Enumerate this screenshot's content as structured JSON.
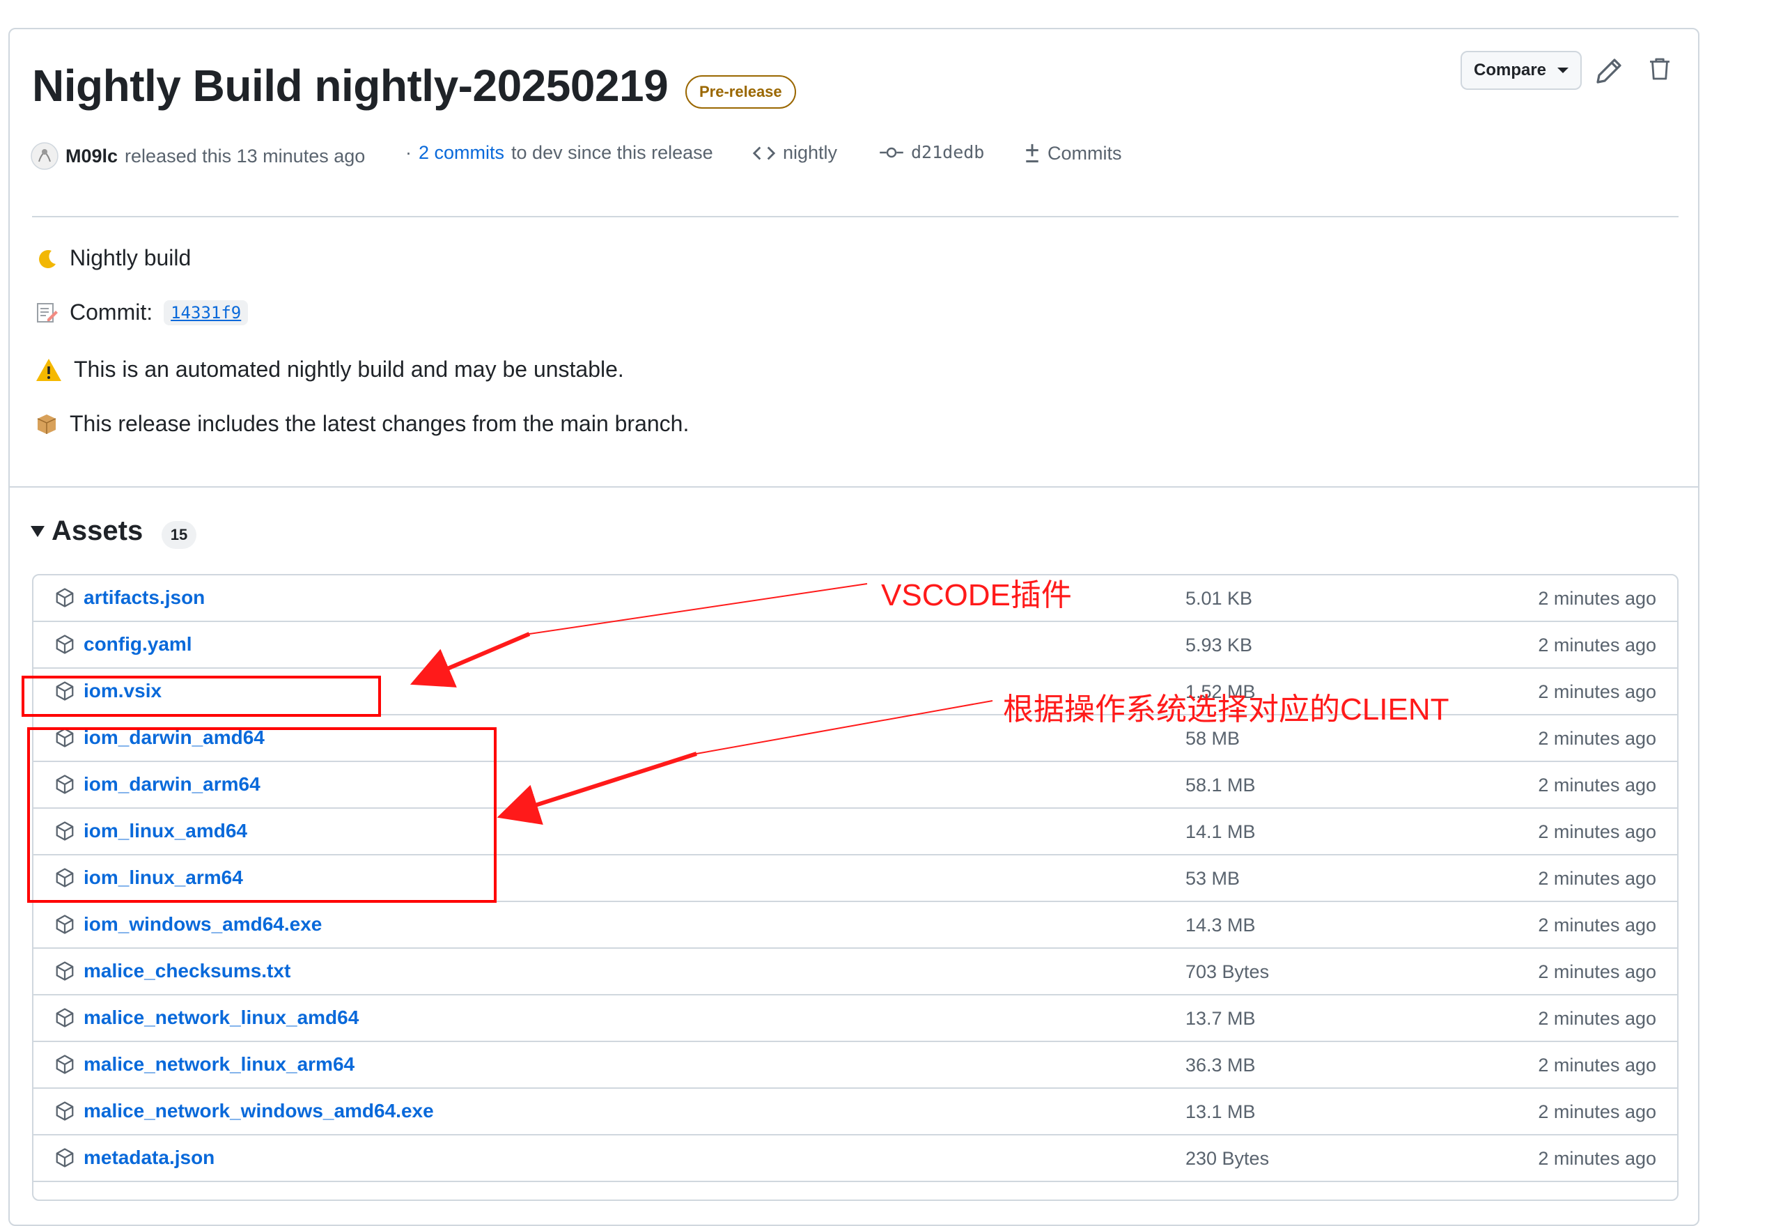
{
  "release": {
    "title": "Nightly Build nightly-20250219",
    "badge": "Pre-release",
    "compare_label": "Compare",
    "author": "M09lc",
    "released_text": "released this 13 minutes ago",
    "commits_link": "2 commits",
    "commits_suffix": "to dev since this release",
    "tag": "nightly",
    "commit_sha": "d21dedb",
    "commits_label": "Commits",
    "icons": [
      "edit-icon",
      "trash-icon",
      "code-icon",
      "commit-icon",
      "compare-icon"
    ]
  },
  "notes": {
    "line1": "Nightly build",
    "line2_prefix": "Commit:",
    "line2_code": "14331f9",
    "line3": "This is an automated nightly build and may be unstable.",
    "line4": "This release includes the latest changes from the main branch."
  },
  "assets": {
    "heading": "Assets",
    "count": "15",
    "rows": [
      {
        "name": "artifacts.json",
        "size": "5.01 KB",
        "time": "2 minutes ago"
      },
      {
        "name": "config.yaml",
        "size": "5.93 KB",
        "time": "2 minutes ago"
      },
      {
        "name": "iom.vsix",
        "size": "1.52 MB",
        "time": "2 minutes ago"
      },
      {
        "name": "iom_darwin_amd64",
        "size": "58 MB",
        "time": "2 minutes ago"
      },
      {
        "name": "iom_darwin_arm64",
        "size": "58.1 MB",
        "time": "2 minutes ago"
      },
      {
        "name": "iom_linux_amd64",
        "size": "14.1 MB",
        "time": "2 minutes ago"
      },
      {
        "name": "iom_linux_arm64",
        "size": "53 MB",
        "time": "2 minutes ago"
      },
      {
        "name": "iom_windows_amd64.exe",
        "size": "14.3 MB",
        "time": "2 minutes ago"
      },
      {
        "name": "malice_checksums.txt",
        "size": "703 Bytes",
        "time": "2 minutes ago"
      },
      {
        "name": "malice_network_linux_amd64",
        "size": "13.7 MB",
        "time": "2 minutes ago"
      },
      {
        "name": "malice_network_linux_arm64",
        "size": "36.3 MB",
        "time": "2 minutes ago"
      },
      {
        "name": "malice_network_windows_amd64.exe",
        "size": "13.1 MB",
        "time": "2 minutes ago"
      },
      {
        "name": "metadata.json",
        "size": "230 Bytes",
        "time": "2 minutes ago"
      }
    ]
  },
  "annotations": {
    "vscode": "VSCODE插件",
    "client": "根据操作系统选择对应的CLIENT",
    "color": "#ff0000"
  }
}
